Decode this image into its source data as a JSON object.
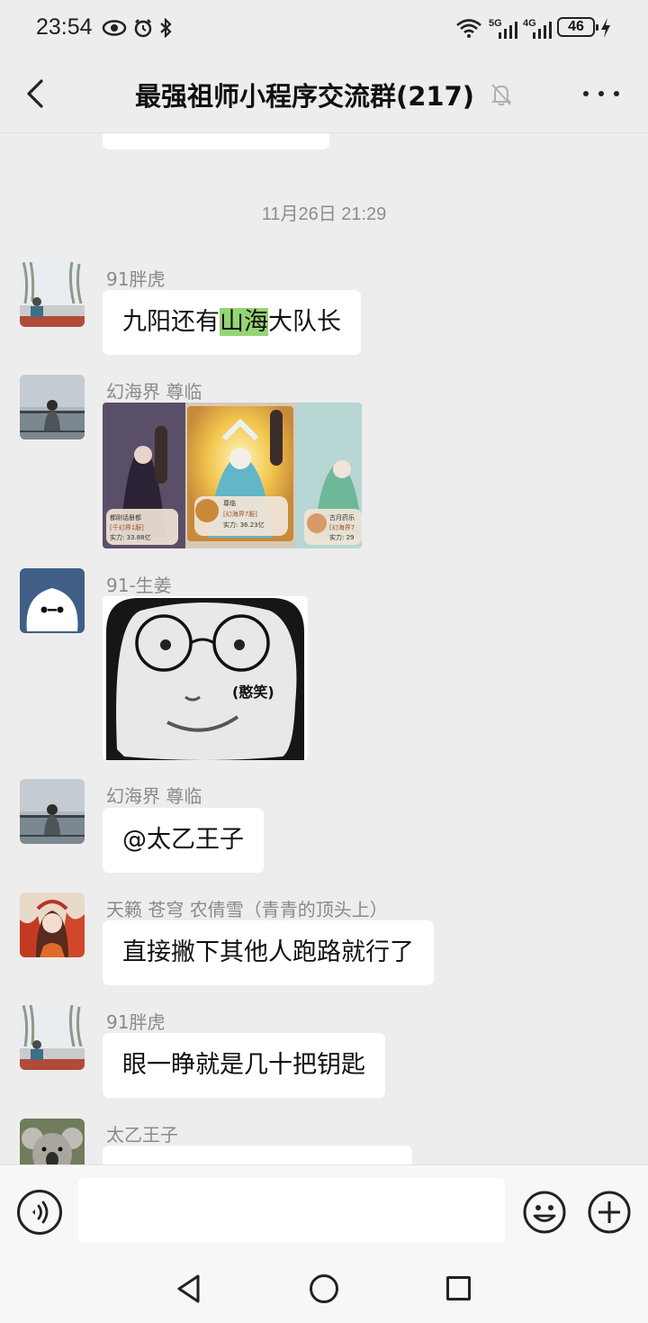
{
  "status_bar": {
    "time": "23:54",
    "net_5g": "5G",
    "net_4g": "4G",
    "battery": "46"
  },
  "header": {
    "title": "最强祖师小程序交流群(217)"
  },
  "chat": {
    "timestamp": "11月26日 21:29",
    "messages": [
      {
        "sender": "91胖虎",
        "text_pre": "九阳还有",
        "text_highlight": "山海",
        "text_post": "大队长"
      },
      {
        "sender": "幻海界 尊临",
        "type": "image",
        "cards": [
          {
            "name": "都刚话册都",
            "server": "[千幻界1服]",
            "power": "实力: 33.88亿"
          },
          {
            "badge": "尊临",
            "server": "[幻海界7服]",
            "power": "实力: 36.23亿"
          },
          {
            "name": "古月药乐",
            "server": "[幻海界7",
            "power": "实力: 29"
          }
        ]
      },
      {
        "sender": "91-生姜",
        "type": "sticker",
        "caption": "(憨笑)"
      },
      {
        "sender": "幻海界 尊临",
        "text": "@太乙王子"
      },
      {
        "sender": "天籁 苍穹 农倩雪（青青的顶头上）",
        "text": "直接撇下其他人跑路就行了"
      },
      {
        "sender": "91胖虎",
        "text": "眼一睁就是几十把钥匙"
      },
      {
        "sender": "太乙王子",
        "text": ""
      }
    ]
  },
  "colors": {
    "background": "#ededed",
    "bubble": "#ffffff",
    "highlight": "#95d475",
    "meta_text": "#8a8a8a"
  },
  "icons": [
    "back-icon",
    "mute-bell-icon",
    "more-icon",
    "voice-icon",
    "emoji-icon",
    "plus-icon",
    "nav-back-icon",
    "nav-home-icon",
    "nav-recent-icon"
  ]
}
